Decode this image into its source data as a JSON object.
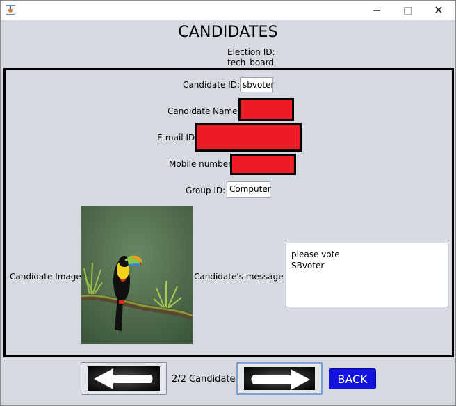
{
  "window": {
    "title": ""
  },
  "header": {
    "title": "CANDIDATES",
    "election_id_label": "Election ID:",
    "election_id_value": "tech_board"
  },
  "form": {
    "candidate_id_label": "Candidate ID:",
    "candidate_id_value": "sbvoter",
    "candidate_name_label": "Candidate Name:",
    "email_label": "E-mail ID:",
    "mobile_label": "Mobile number:",
    "group_id_label": "Group ID:",
    "group_id_value": "Computer",
    "candidate_image_label": "Candidate Image",
    "candidate_message_label": "Candidate's message",
    "message_lines": [
      "please vote",
      "SBvoter"
    ]
  },
  "footer": {
    "counter": "2/2 Candidate",
    "back_label": "BACK",
    "prev_icon": "left-arrow-icon",
    "next_icon": "right-arrow-icon"
  },
  "colors": {
    "redaction": "#ed1c24",
    "back_button": "#1212e0",
    "window_background": "#d6d9df"
  }
}
